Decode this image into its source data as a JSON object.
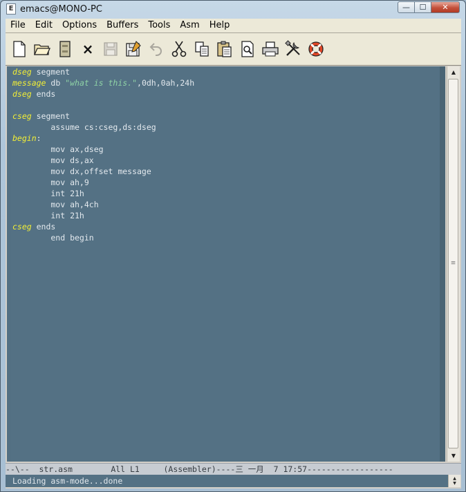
{
  "window": {
    "title": "emacs@MONO-PC",
    "app_icon_glyph": "E",
    "buttons": {
      "minimize": "—",
      "maximize": "☐",
      "close": "✕"
    }
  },
  "menu": {
    "items": [
      "File",
      "Edit",
      "Options",
      "Buffers",
      "Tools",
      "Asm",
      "Help"
    ]
  },
  "toolbar": {
    "icons": [
      "new-file-icon",
      "open-folder-icon",
      "open-directory-icon",
      "close-buffer-icon",
      "save-icon",
      "save-as-icon",
      "undo-icon",
      "cut-icon",
      "copy-icon",
      "paste-icon",
      "search-icon",
      "print-icon",
      "preferences-icon",
      "help-icon"
    ],
    "close_glyph": "×"
  },
  "editor": {
    "colors": {
      "background": "#547184",
      "keyword": "#f3ef35",
      "string": "#8fd3a6",
      "text": "#e3e9ee"
    },
    "lines": [
      [
        {
          "t": "dseg",
          "c": "kw"
        },
        {
          "t": " segment",
          "c": "plain"
        }
      ],
      [
        {
          "t": "message",
          "c": "kw"
        },
        {
          "t": " db ",
          "c": "plain"
        },
        {
          "t": "\"what is this.\"",
          "c": "str"
        },
        {
          "t": ",0dh,0ah,24h",
          "c": "plain"
        }
      ],
      [
        {
          "t": "dseg",
          "c": "kw"
        },
        {
          "t": " ends",
          "c": "plain"
        }
      ],
      [],
      [
        {
          "t": "cseg",
          "c": "kw"
        },
        {
          "t": " segment",
          "c": "plain"
        }
      ],
      [
        {
          "t": "        assume cs:cseg,ds:dseg",
          "c": "plain"
        }
      ],
      [
        {
          "t": "begin",
          "c": "kw"
        },
        {
          "t": ":",
          "c": "plain"
        }
      ],
      [
        {
          "t": "        mov ax,dseg",
          "c": "plain"
        }
      ],
      [
        {
          "t": "        mov ds,ax",
          "c": "plain"
        }
      ],
      [
        {
          "t": "        mov dx,offset message",
          "c": "plain"
        }
      ],
      [
        {
          "t": "        mov ah,9",
          "c": "plain"
        }
      ],
      [
        {
          "t": "        int 21h",
          "c": "plain"
        }
      ],
      [
        {
          "t": "        mov ah,4ch",
          "c": "plain"
        }
      ],
      [
        {
          "t": "        int 21h",
          "c": "plain"
        }
      ],
      [
        {
          "t": "cseg",
          "c": "kw"
        },
        {
          "t": " ends",
          "c": "plain"
        }
      ],
      [
        {
          "t": "        end begin",
          "c": "plain"
        }
      ]
    ]
  },
  "scrollbar": {
    "up": "▲",
    "down": "▼",
    "grip": "≡"
  },
  "modeline": {
    "text": "--\\--  str.asm        All L1     (Assembler)----三 一月  7 17:57------------------"
  },
  "minibuffer": {
    "text": "Loading asm-mode...done"
  }
}
